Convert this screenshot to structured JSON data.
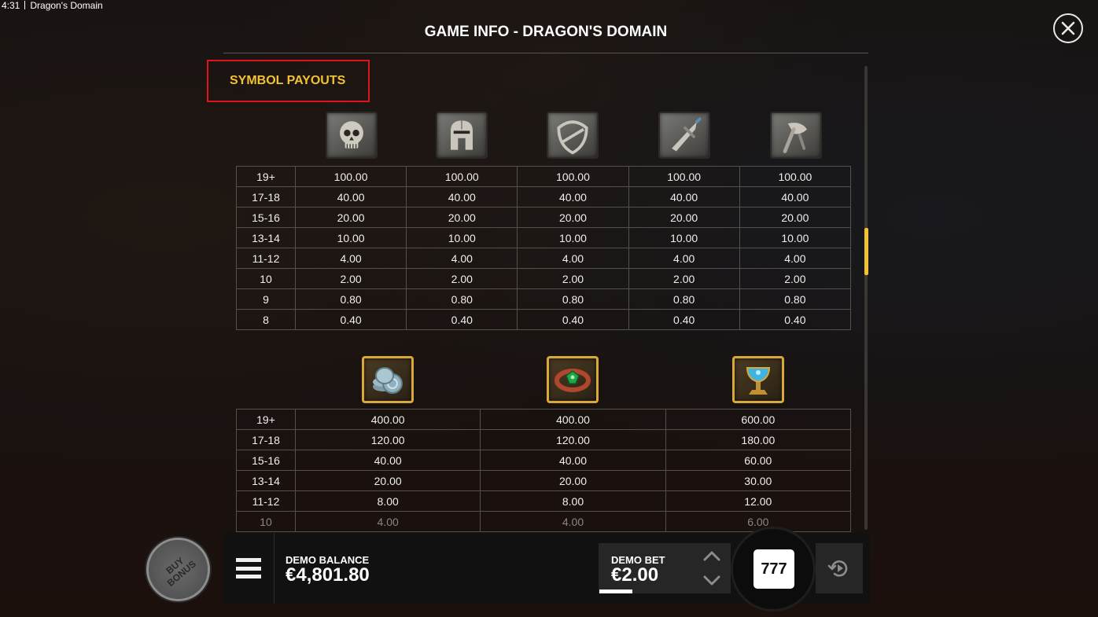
{
  "window": {
    "time": "4:31",
    "title": "Dragon's Domain"
  },
  "info": {
    "title": "GAME INFO - DRAGON'S DOMAIN",
    "section": "SYMBOL PAYOUTS"
  },
  "table1": {
    "symbols": [
      "skull-icon",
      "helmet-icon",
      "shield-icon",
      "sword-icon",
      "axe-icon"
    ],
    "rows": [
      {
        "label": "19+",
        "values": [
          "100.00",
          "100.00",
          "100.00",
          "100.00",
          "100.00"
        ]
      },
      {
        "label": "17-18",
        "values": [
          "40.00",
          "40.00",
          "40.00",
          "40.00",
          "40.00"
        ]
      },
      {
        "label": "15-16",
        "values": [
          "20.00",
          "20.00",
          "20.00",
          "20.00",
          "20.00"
        ]
      },
      {
        "label": "13-14",
        "values": [
          "10.00",
          "10.00",
          "10.00",
          "10.00",
          "10.00"
        ]
      },
      {
        "label": "11-12",
        "values": [
          "4.00",
          "4.00",
          "4.00",
          "4.00",
          "4.00"
        ]
      },
      {
        "label": "10",
        "values": [
          "2.00",
          "2.00",
          "2.00",
          "2.00",
          "2.00"
        ]
      },
      {
        "label": "9",
        "values": [
          "0.80",
          "0.80",
          "0.80",
          "0.80",
          "0.80"
        ]
      },
      {
        "label": "8",
        "values": [
          "0.40",
          "0.40",
          "0.40",
          "0.40",
          "0.40"
        ]
      }
    ]
  },
  "table2": {
    "symbols": [
      "coins-icon",
      "emerald-ring-icon",
      "chalice-icon"
    ],
    "rows": [
      {
        "label": "19+",
        "values": [
          "400.00",
          "400.00",
          "600.00"
        ]
      },
      {
        "label": "17-18",
        "values": [
          "120.00",
          "120.00",
          "180.00"
        ]
      },
      {
        "label": "15-16",
        "values": [
          "40.00",
          "40.00",
          "60.00"
        ]
      },
      {
        "label": "13-14",
        "values": [
          "20.00",
          "20.00",
          "30.00"
        ]
      },
      {
        "label": "11-12",
        "values": [
          "8.00",
          "8.00",
          "12.00"
        ]
      },
      {
        "label": "10",
        "values": [
          "4.00",
          "4.00",
          "6.00"
        ]
      }
    ]
  },
  "controls": {
    "buy_bonus": "BUY BONUS",
    "balance_label": "DEMO BALANCE",
    "balance_value": "€4,801.80",
    "bet_label": "DEMO BET",
    "bet_value": "€2.00",
    "spin_label": "777"
  },
  "colors": {
    "accent": "#f2c232",
    "highlight_box": "#e0141e"
  }
}
